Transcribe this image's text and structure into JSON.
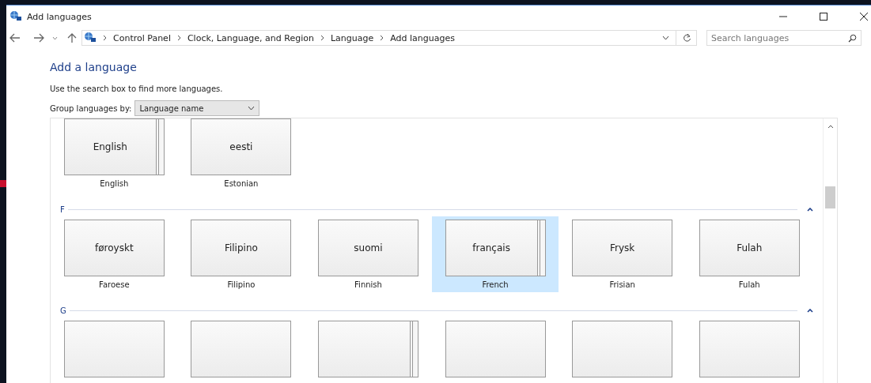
{
  "window": {
    "title": "Add languages"
  },
  "address_bar": {
    "crumbs": [
      "Control Panel",
      "Clock, Language, and Region",
      "Language",
      "Add languages"
    ]
  },
  "search": {
    "placeholder": "Search languages"
  },
  "heading": "Add a language",
  "instruction": "Use the search box to find more languages.",
  "group_by": {
    "label": "Group languages by:",
    "value": "Language name"
  },
  "groups": [
    {
      "tiles": [
        {
          "native": "English",
          "name": "English",
          "stacked": true,
          "selected": false
        },
        {
          "native": "eesti",
          "name": "Estonian",
          "stacked": false,
          "selected": false
        }
      ]
    },
    {
      "letter": "F",
      "expanded": true,
      "tiles": [
        {
          "native": "føroyskt",
          "name": "Faroese",
          "stacked": false,
          "selected": false
        },
        {
          "native": "Filipino",
          "name": "Filipino",
          "stacked": false,
          "selected": false
        },
        {
          "native": "suomi",
          "name": "Finnish",
          "stacked": false,
          "selected": false
        },
        {
          "native": "français",
          "name": "French",
          "stacked": true,
          "selected": true
        },
        {
          "native": "Frysk",
          "name": "Frisian",
          "stacked": false,
          "selected": false
        },
        {
          "native": "Fulah",
          "name": "Fulah",
          "stacked": false,
          "selected": false
        }
      ]
    },
    {
      "letter": "G",
      "expanded": true,
      "tiles": [
        {
          "stacked": false,
          "selected": false
        },
        {
          "stacked": false,
          "selected": false
        },
        {
          "stacked": true,
          "selected": false
        },
        {
          "stacked": false,
          "selected": false
        },
        {
          "stacked": false,
          "selected": false
        },
        {
          "stacked": false,
          "selected": false
        }
      ]
    }
  ]
}
